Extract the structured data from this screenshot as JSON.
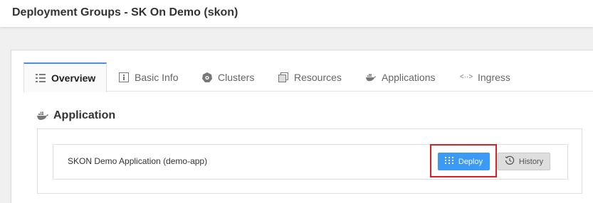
{
  "header": {
    "title": "Deployment Groups - SK On Demo (skon)"
  },
  "tabs": [
    {
      "label": "Overview",
      "icon": "list-icon"
    },
    {
      "label": "Basic Info",
      "icon": "info-icon"
    },
    {
      "label": "Clusters",
      "icon": "kubernetes-icon"
    },
    {
      "label": "Resources",
      "icon": "copy-icon"
    },
    {
      "label": "Applications",
      "icon": "docker-icon"
    },
    {
      "label": "Ingress",
      "icon": "code-icon"
    }
  ],
  "active_tab": "Overview",
  "section": {
    "title": "Application",
    "icon": "docker-icon"
  },
  "application": {
    "name": "SKON Demo Application (demo-app)",
    "deploy_label": "Deploy",
    "history_label": "History"
  },
  "colors": {
    "accent": "#4a90e2",
    "deploy_button": "#3a9af5",
    "highlight_frame": "#e02020"
  }
}
